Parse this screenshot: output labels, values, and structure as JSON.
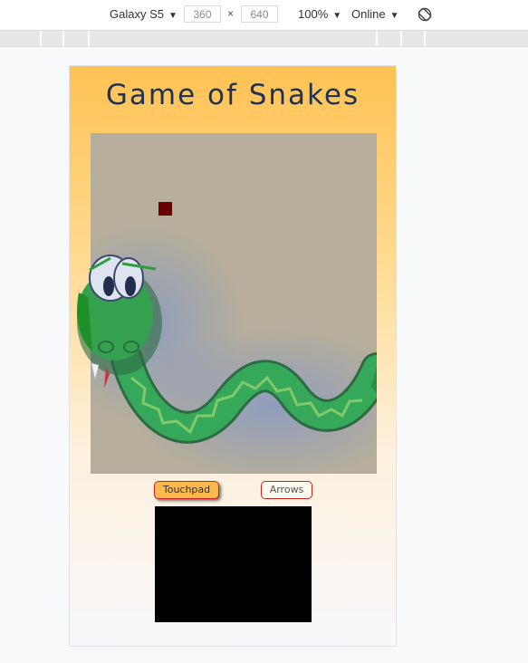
{
  "devtools": {
    "device": "Galaxy S5",
    "width": "360",
    "height": "640",
    "times": "×",
    "zoom": "100%",
    "network": "Online",
    "icons": {
      "caret": "caret-down-icon",
      "rotate": "rotate-icon"
    }
  },
  "page": {
    "title": "Game of Snakes",
    "buttons": {
      "touchpad": "Touchpad",
      "arrows": "Arrows"
    },
    "colors": {
      "title": "#1f3256",
      "board": "#b6ae9b",
      "food": "#6b0000",
      "snake_segment": "#000000",
      "button_border": "#cc2222",
      "button_active": "#ffb84a",
      "touchpad": "#000000"
    }
  }
}
